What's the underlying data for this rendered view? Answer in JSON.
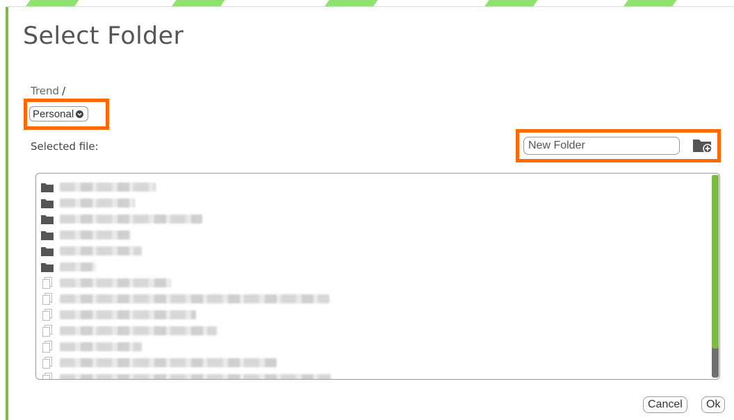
{
  "dialog": {
    "title": "Select Folder",
    "breadcrumb": {
      "root": "Trend",
      "separator": "/"
    },
    "folder_select": {
      "selected": "Personal"
    },
    "selected_file_label": "Selected file:",
    "new_folder": {
      "placeholder": "New Folder",
      "icon": "add-folder-icon"
    },
    "file_list": {
      "items": [
        {
          "type": "folder",
          "icon": "folder-icon"
        },
        {
          "type": "folder",
          "icon": "folder-icon"
        },
        {
          "type": "folder",
          "icon": "folder-icon"
        },
        {
          "type": "folder",
          "icon": "folder-icon"
        },
        {
          "type": "folder",
          "icon": "folder-icon"
        },
        {
          "type": "folder",
          "icon": "folder-icon"
        },
        {
          "type": "file",
          "icon": "file-icon"
        },
        {
          "type": "file",
          "icon": "file-icon"
        },
        {
          "type": "file",
          "icon": "file-icon"
        },
        {
          "type": "file",
          "icon": "file-icon"
        },
        {
          "type": "file",
          "icon": "file-icon"
        },
        {
          "type": "file",
          "icon": "file-icon"
        },
        {
          "type": "file",
          "icon": "file-icon"
        }
      ]
    },
    "buttons": {
      "cancel": "Cancel",
      "ok": "Ok"
    }
  },
  "colors": {
    "accent": "#7dbb42",
    "highlight": "#ff6a00",
    "folder_icon": "#555555"
  }
}
